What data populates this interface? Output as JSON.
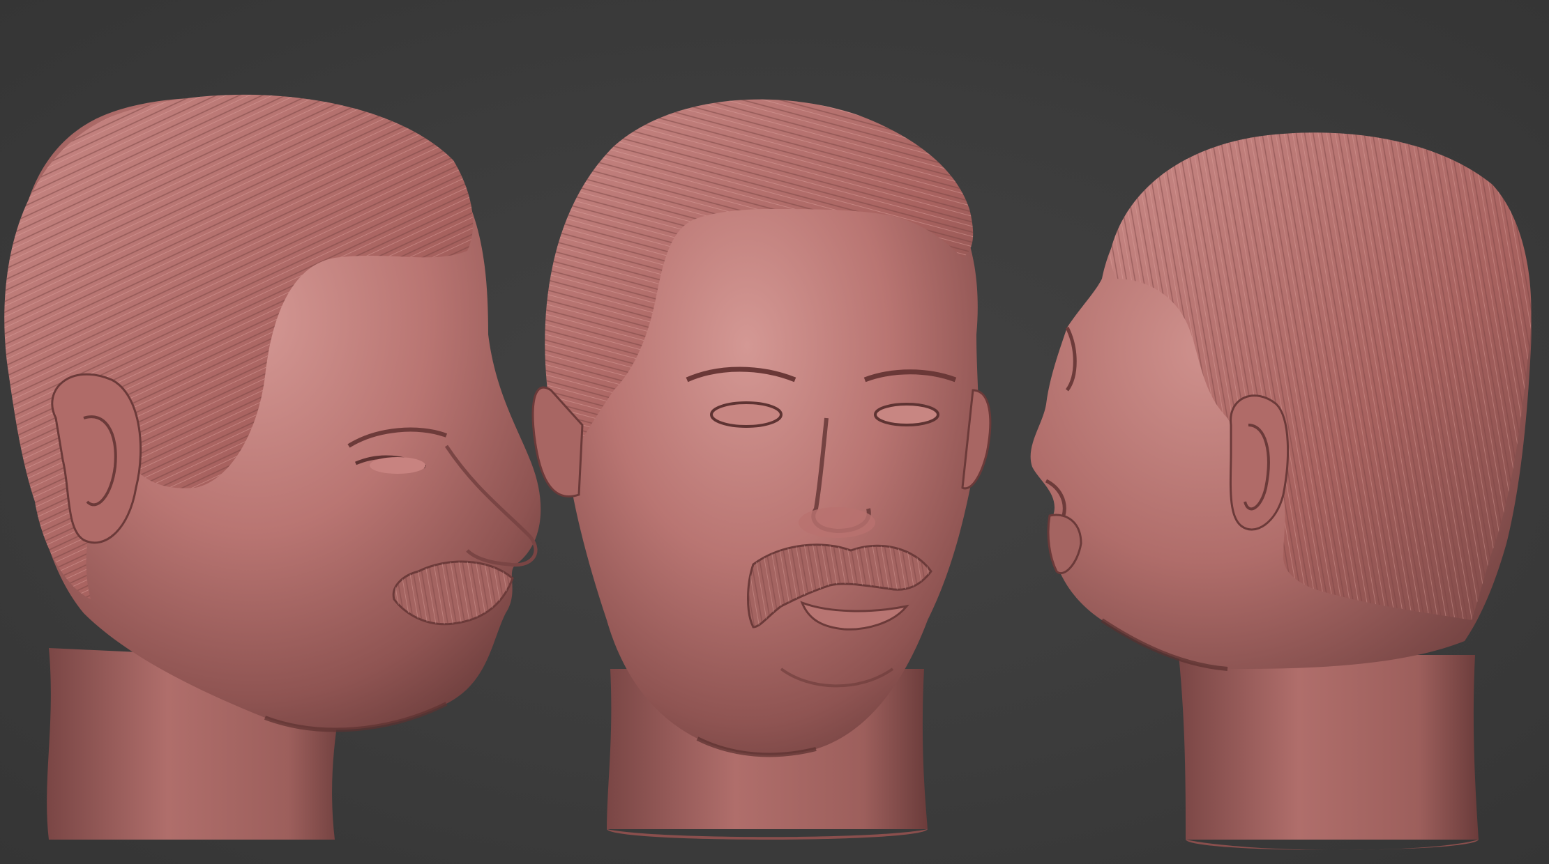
{
  "scene": {
    "background_color": "#3c3c3c",
    "sculpt_color": "#b26f6d",
    "views": [
      {
        "id": "three-quarter",
        "description_icon": "head-three-quarter-view"
      },
      {
        "id": "front",
        "description_icon": "head-front-view"
      },
      {
        "id": "back-three-quarter",
        "description_icon": "head-back-three-quarter-view"
      }
    ]
  }
}
